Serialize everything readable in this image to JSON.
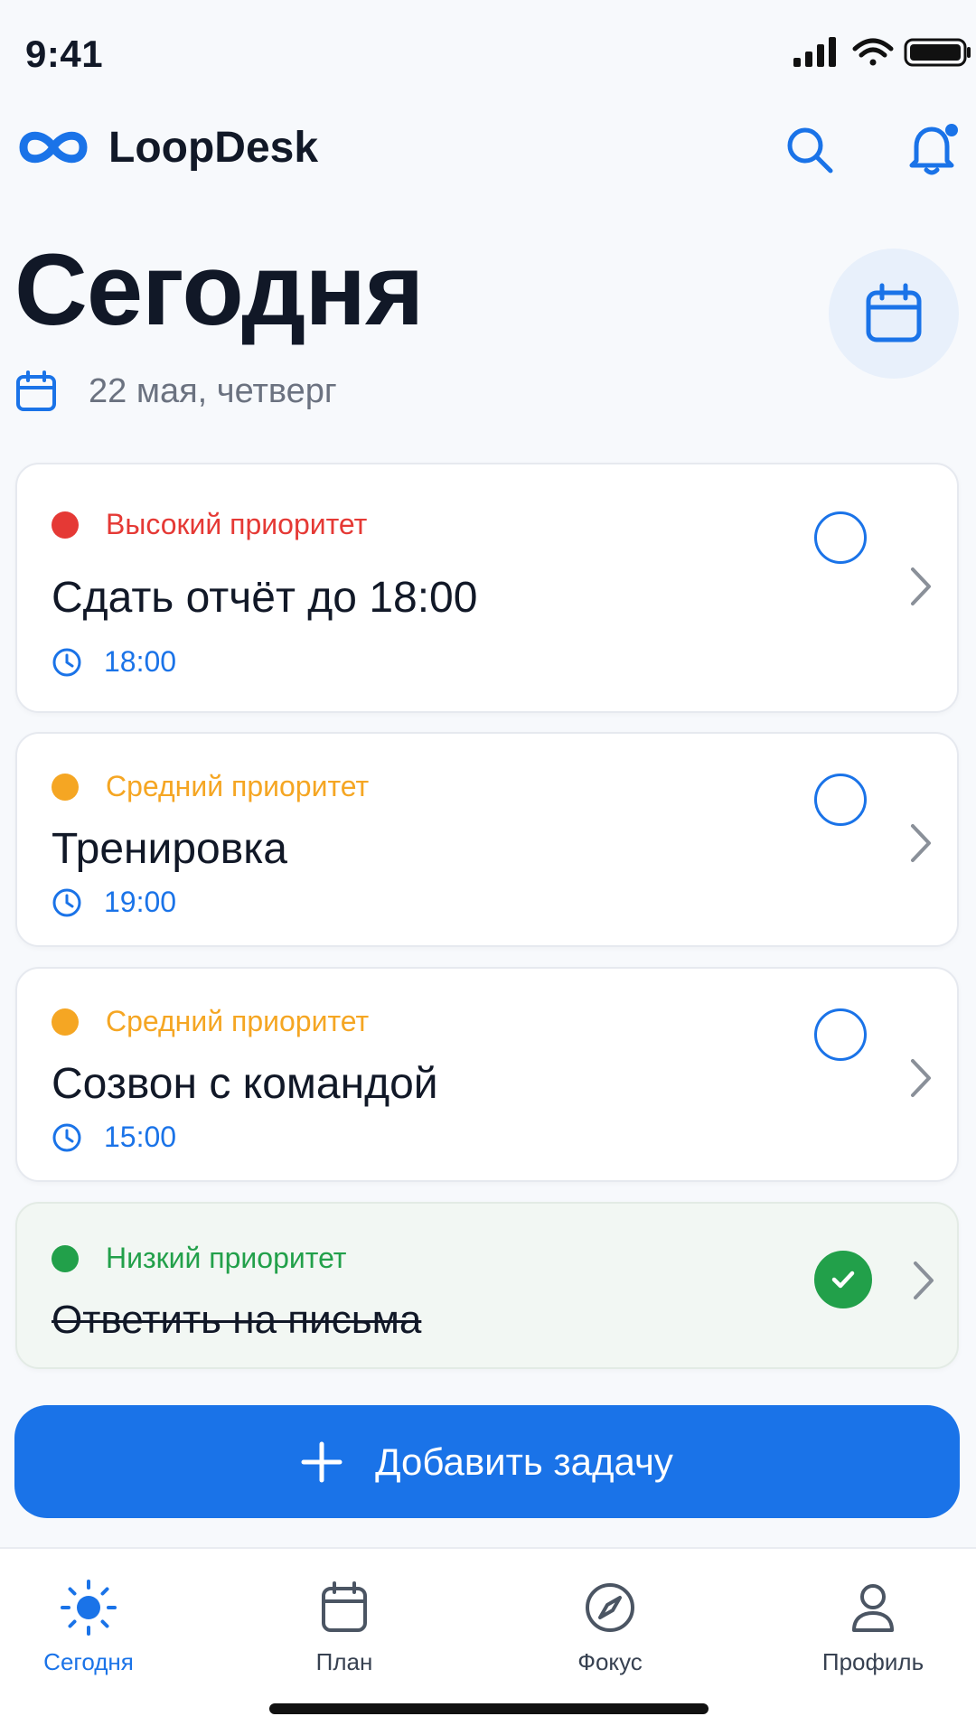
{
  "status_bar": {
    "time": "9:41"
  },
  "header": {
    "app_name": "LoopDesk"
  },
  "page": {
    "title": "Сегодня",
    "date": "22 мая, четверг"
  },
  "tasks": [
    {
      "priority": "Высокий приоритет",
      "priority_color": "#e53935",
      "title": "Сдать отчёт до 18:00",
      "time": "18:00",
      "completed": false
    },
    {
      "priority": "Средний приоритет",
      "priority_color": "#f5a623",
      "title": "Тренировка",
      "time": "19:00",
      "completed": false
    },
    {
      "priority": "Средний приоритет",
      "priority_color": "#f5a623",
      "title": "Созвон с командой",
      "time": "15:00",
      "completed": false
    },
    {
      "priority": "Низкий приоритет",
      "priority_color": "#22a04a",
      "title": "Ответить на письма",
      "time": "",
      "completed": true
    }
  ],
  "add_task_label": "Добавить задачу",
  "nav": {
    "items": [
      {
        "label": "Сегодня",
        "icon": "sun-icon",
        "active": true
      },
      {
        "label": "План",
        "icon": "calendar-icon",
        "active": false
      },
      {
        "label": "Фокус",
        "icon": "compass-icon",
        "active": false
      },
      {
        "label": "Профиль",
        "icon": "person-icon",
        "active": false
      }
    ]
  },
  "colors": {
    "accent": "#1a73e8",
    "high": "#e53935",
    "medium": "#f5a623",
    "low": "#22a04a"
  }
}
